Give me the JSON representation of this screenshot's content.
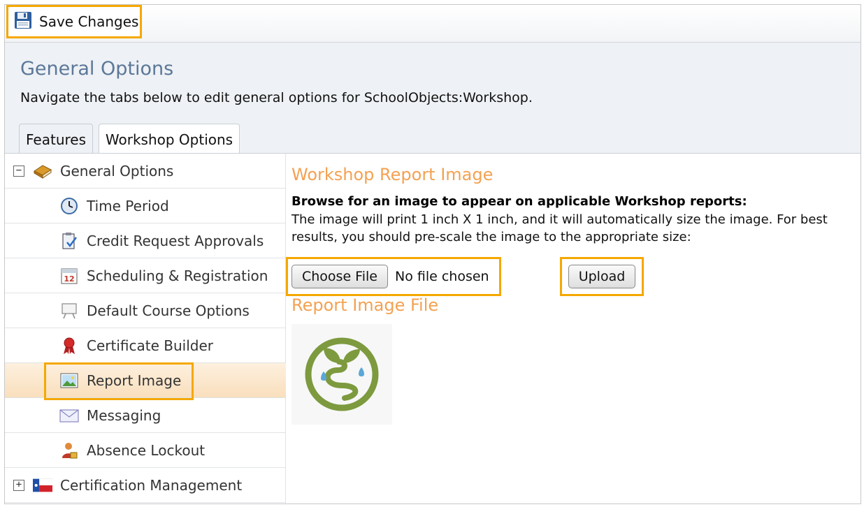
{
  "toolbar": {
    "save_label": "Save Changes"
  },
  "header": {
    "title": "General Options",
    "description": "Navigate the tabs below to edit general options for SchoolObjects:Workshop."
  },
  "tabs": [
    {
      "label": "Features"
    },
    {
      "label": "Workshop Options"
    }
  ],
  "sidebar": {
    "items": [
      {
        "label": "General Options",
        "icon": "book-icon",
        "expander": "−"
      },
      {
        "label": "Time Period",
        "icon": "clock-icon"
      },
      {
        "label": "Credit Request Approvals",
        "icon": "clipboard-check-icon"
      },
      {
        "label": "Scheduling & Registration",
        "icon": "calendar-icon"
      },
      {
        "label": "Default Course Options",
        "icon": "easel-icon"
      },
      {
        "label": "Certificate Builder",
        "icon": "ribbon-award-icon"
      },
      {
        "label": "Report Image",
        "icon": "picture-icon"
      },
      {
        "label": "Messaging",
        "icon": "envelope-icon"
      },
      {
        "label": "Absence Lockout",
        "icon": "user-lock-icon"
      },
      {
        "label": "Certification Management",
        "icon": "flag-icon",
        "expander": "+"
      }
    ],
    "selected": "Report Image"
  },
  "main": {
    "title": "Workshop Report Image",
    "browse_heading": "Browse for an image to appear on applicable Workshop reports:",
    "browse_desc": "The image will print 1 inch X 1 inch, and it will automatically size the image. For best results, you should pre-scale the image to the appropriate size:",
    "choose_file_label": "Choose File",
    "no_file_text": "No file chosen",
    "upload_label": "Upload",
    "file_title": "Report Image File"
  },
  "colors": {
    "accent_orange": "#f3a252",
    "highlight": "#f5a800",
    "title_blue": "#5b7898",
    "logo_green": "#7d9a3f",
    "logo_blue": "#5ba7d6"
  }
}
